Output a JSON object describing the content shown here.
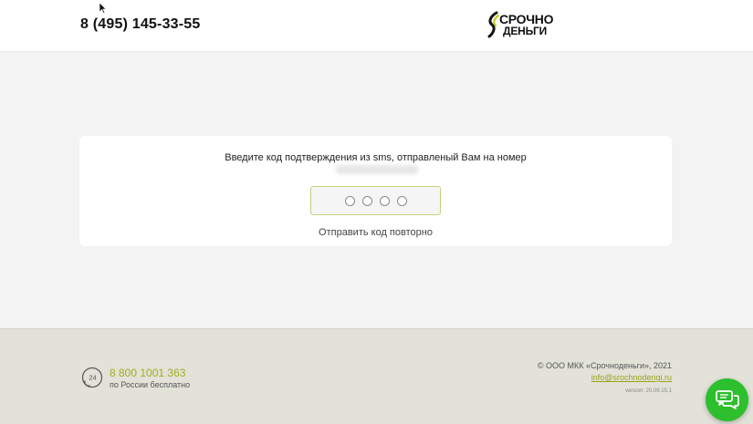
{
  "header": {
    "phone": "8 (495) 145-33-55",
    "logo": {
      "line1": "СРОЧНО",
      "line2": "ДЕНЬГИ"
    }
  },
  "verification": {
    "prompt": "Введите код подтверждения из sms, отправленый Вам на номер",
    "code_digits": 4,
    "resend_label": "Отправить код повторно"
  },
  "footer": {
    "hotline": "8 800 1001 363",
    "hotline_note": "по России бесплатно",
    "hotline_icon": "24",
    "copyright": "© ООО МКК «Срочноденьги», 2021",
    "email": "info@srochnodengi.ru",
    "version": "version: 20.09.15.1"
  },
  "colors": {
    "accent": "#a3ad1e",
    "chat_button": "#2dbf2d",
    "code_border": "#c8d07a",
    "footer_bg": "#e2e2d9"
  },
  "icons": {
    "chat": "chat-bubbles-icon",
    "hotline": "phone-24-icon",
    "cursor": "mouse-cursor-icon"
  }
}
